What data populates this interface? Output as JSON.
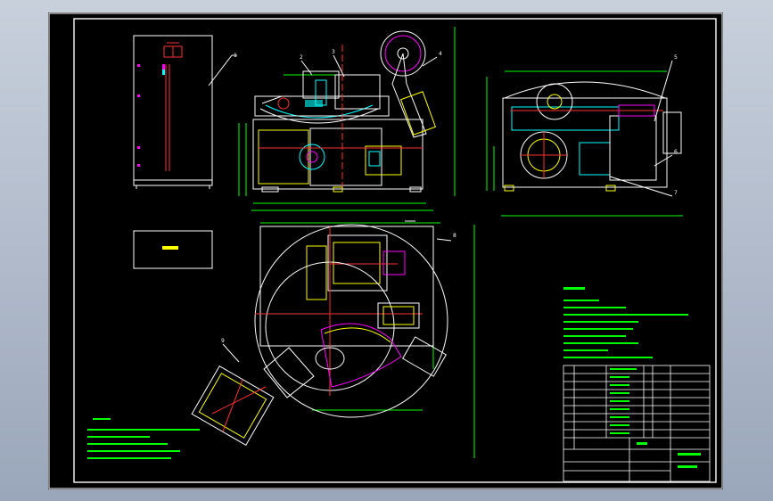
{
  "drawing": {
    "balloons": {
      "b1": "1",
      "b2": "2",
      "b3": "3",
      "b4": "4",
      "b5": "5",
      "b6": "6",
      "b7": "7",
      "b8": "8",
      "b9": "9"
    },
    "colors": {
      "background": "#000000",
      "border": "#ffffff",
      "outline": "#ffffff",
      "hidden_line": "#ffff00",
      "center_line": "#ff3030",
      "dimension": "#00ff00",
      "leader": "#ffffff",
      "part": "#00ffff",
      "accent": "#ff00ff"
    }
  }
}
